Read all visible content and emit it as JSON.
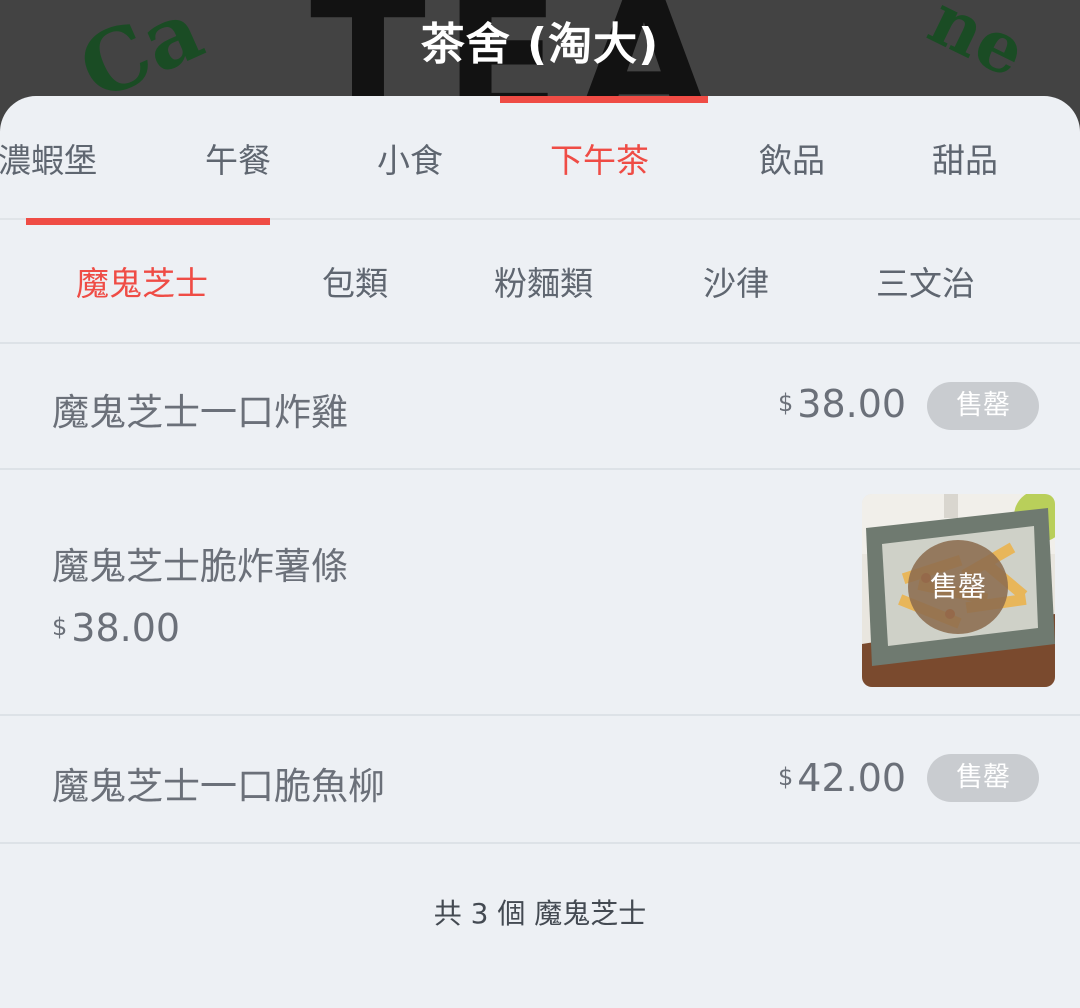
{
  "store": {
    "title": "茶舍 (淘大)",
    "banner_left_text": "Ca",
    "banner_center_text": "TEA",
    "banner_right_text": "ne"
  },
  "category_tabs": [
    {
      "label": "濃蝦堡",
      "active": false
    },
    {
      "label": "午餐",
      "active": false
    },
    {
      "label": "小食",
      "active": false
    },
    {
      "label": "下午茶",
      "active": true
    },
    {
      "label": "飲品",
      "active": false
    },
    {
      "label": "甜品",
      "active": false
    }
  ],
  "sub_tabs": [
    {
      "label": "魔鬼芝士",
      "active": true
    },
    {
      "label": "包類",
      "active": false
    },
    {
      "label": "粉麵類",
      "active": false
    },
    {
      "label": "沙律",
      "active": false
    },
    {
      "label": "三文治",
      "active": false
    }
  ],
  "items": [
    {
      "name": "魔鬼芝士一口炸雞",
      "currency": "$",
      "price": "38.00",
      "status": "售罄"
    },
    {
      "name": "魔鬼芝士脆炸薯條",
      "currency": "$",
      "price": "38.00",
      "status": "售罄",
      "image_icon": "fries-dish-icon"
    },
    {
      "name": "魔鬼芝士一口脆魚柳",
      "currency": "$",
      "price": "42.00",
      "status": "售罄"
    }
  ],
  "footer": {
    "count_text": "共 3 個 魔鬼芝士"
  },
  "colors": {
    "accent": "#ef4c45",
    "background": "#edf0f4",
    "sold_badge": "#c9ccd0",
    "text": "#6b7079"
  }
}
